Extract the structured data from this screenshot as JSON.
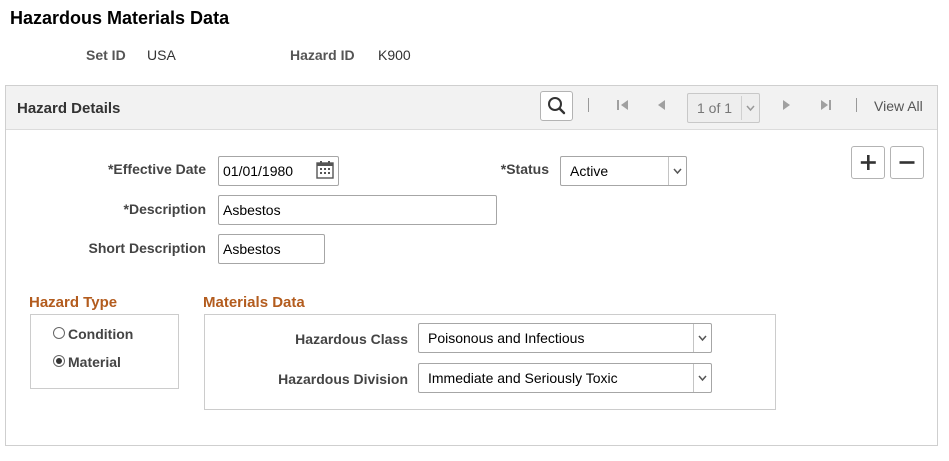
{
  "page": {
    "title": "Hazardous Materials Data"
  },
  "keys": {
    "set_id_label": "Set ID",
    "set_id_value": "USA",
    "hazard_id_label": "Hazard ID",
    "hazard_id_value": "K900"
  },
  "panel": {
    "title": "Hazard Details",
    "nav": {
      "page_indicator": "1 of 1",
      "view_all": "View All"
    }
  },
  "form": {
    "effective_date_label": "*Effective Date",
    "effective_date_value": "01/01/1980",
    "status_label": "*Status",
    "status_value": "Active",
    "description_label": "*Description",
    "description_value": "Asbestos",
    "short_description_label": "Short Description",
    "short_description_value": "Asbestos"
  },
  "hazard_type": {
    "title": "Hazard Type",
    "options": [
      {
        "label": "Condition",
        "selected": false
      },
      {
        "label": "Material",
        "selected": true
      }
    ]
  },
  "materials_data": {
    "title": "Materials Data",
    "hazardous_class_label": "Hazardous Class",
    "hazardous_class_value": "Poisonous and Infectious",
    "hazardous_division_label": "Hazardous Division",
    "hazardous_division_value": "Immediate and Seriously Toxic"
  },
  "icons": {
    "search": "search-icon",
    "first": "first-page-icon",
    "previous": "previous-page-icon",
    "next": "next-page-icon",
    "last": "last-page-icon",
    "calendar": "calendar-icon",
    "add": "plus-icon",
    "delete": "minus-icon",
    "dropdown": "chevron-down-icon"
  },
  "colors": {
    "section_title": "#b35c1e",
    "header_bg": "#f2f2f2"
  }
}
